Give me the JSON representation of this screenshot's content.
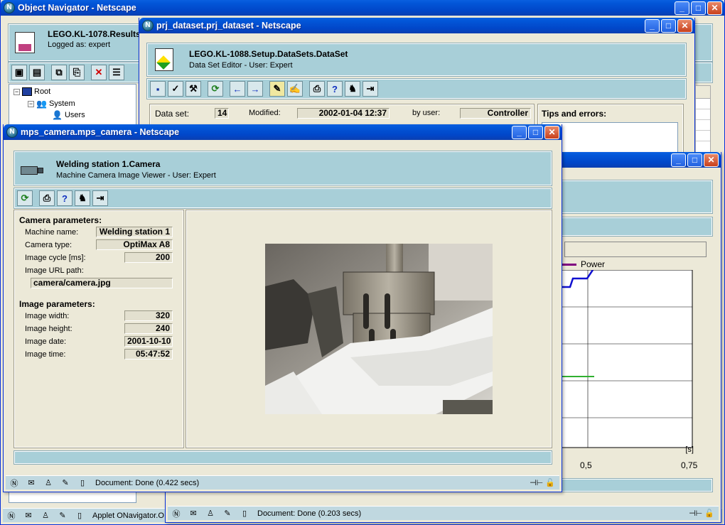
{
  "object_navigator": {
    "title": "Object Navigator - Netscape",
    "header_title": "LEGO.KL-1078.Results",
    "header_sub": "Logged as: expert",
    "tree": [
      {
        "label": "Root"
      },
      {
        "label": "System"
      },
      {
        "label": "Users"
      }
    ],
    "status": "Applet ONavigator.O"
  },
  "dataset_window": {
    "title": "prj_dataset.prj_dataset - Netscape",
    "header_title": "LEGO.KL-1088.Setup.DataSets.DataSet",
    "header_sub": "Data Set Editor - User: Expert",
    "dataset_label": "Data set:",
    "dataset_value": "14",
    "modified_label": "Modified:",
    "modified_value": "2002-01-04 12:37",
    "byuser_label": "by user:",
    "byuser_value": "Controller",
    "tips_label": "Tips and errors:",
    "status": "Document: Done (0.203 secs)"
  },
  "chart_window": {
    "legend": "Power",
    "x_ticks": [
      "0,5",
      "0,75"
    ],
    "unit": "[s]",
    "accent_blue": "#1010d0",
    "accent_green": "#30b030",
    "legend_color": "#800080"
  },
  "camera_window": {
    "title": "mps_camera.mps_camera - Netscape",
    "header_title": "Welding station 1.Camera",
    "header_sub": "Machine Camera Image Viewer - User: Expert",
    "camera_section": "Camera parameters:",
    "machine_name_label": "Machine name:",
    "machine_name": "Welding station 1",
    "camera_type_label": "Camera type:",
    "camera_type": "OptiMax A8",
    "image_cycle_label": "Image cycle [ms]:",
    "image_cycle": "200",
    "image_url_label": "Image URL path:",
    "image_url": "camera/camera.jpg",
    "image_section": "Image parameters:",
    "image_width_label": "Image width:",
    "image_width": "320",
    "image_height_label": "Image height:",
    "image_height": "240",
    "image_date_label": "Image date:",
    "image_date": "2001-10-10",
    "image_time_label": "Image time:",
    "image_time": "05:47:52",
    "status": "Document: Done (0.422 secs)"
  }
}
